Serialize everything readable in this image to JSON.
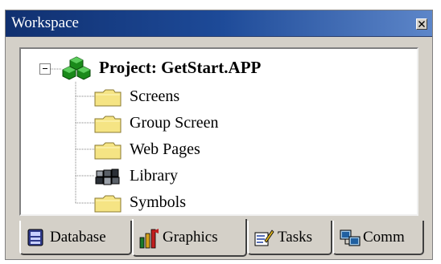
{
  "window": {
    "title": "Workspace"
  },
  "tree": {
    "root_label": "Project: GetStart.APP",
    "items": [
      {
        "label": "Screens",
        "icon": "folder-icon"
      },
      {
        "label": "Group Screen",
        "icon": "folder-icon"
      },
      {
        "label": "Web Pages",
        "icon": "folder-icon"
      },
      {
        "label": "Library",
        "icon": "library-icon"
      },
      {
        "label": "Symbols",
        "icon": "folder-icon"
      }
    ]
  },
  "tabs": [
    {
      "label": "Database",
      "icon": "database-icon"
    },
    {
      "label": "Graphics",
      "icon": "graphics-icon",
      "active": true
    },
    {
      "label": "Tasks",
      "icon": "tasks-icon"
    },
    {
      "label": "Comm",
      "icon": "comm-icon"
    }
  ],
  "colors": {
    "title_bar": "#1d4a98",
    "panel_bg": "#d4d0c8",
    "folder_yellow": "#f5e484",
    "project_green": "#1a8a1a"
  }
}
